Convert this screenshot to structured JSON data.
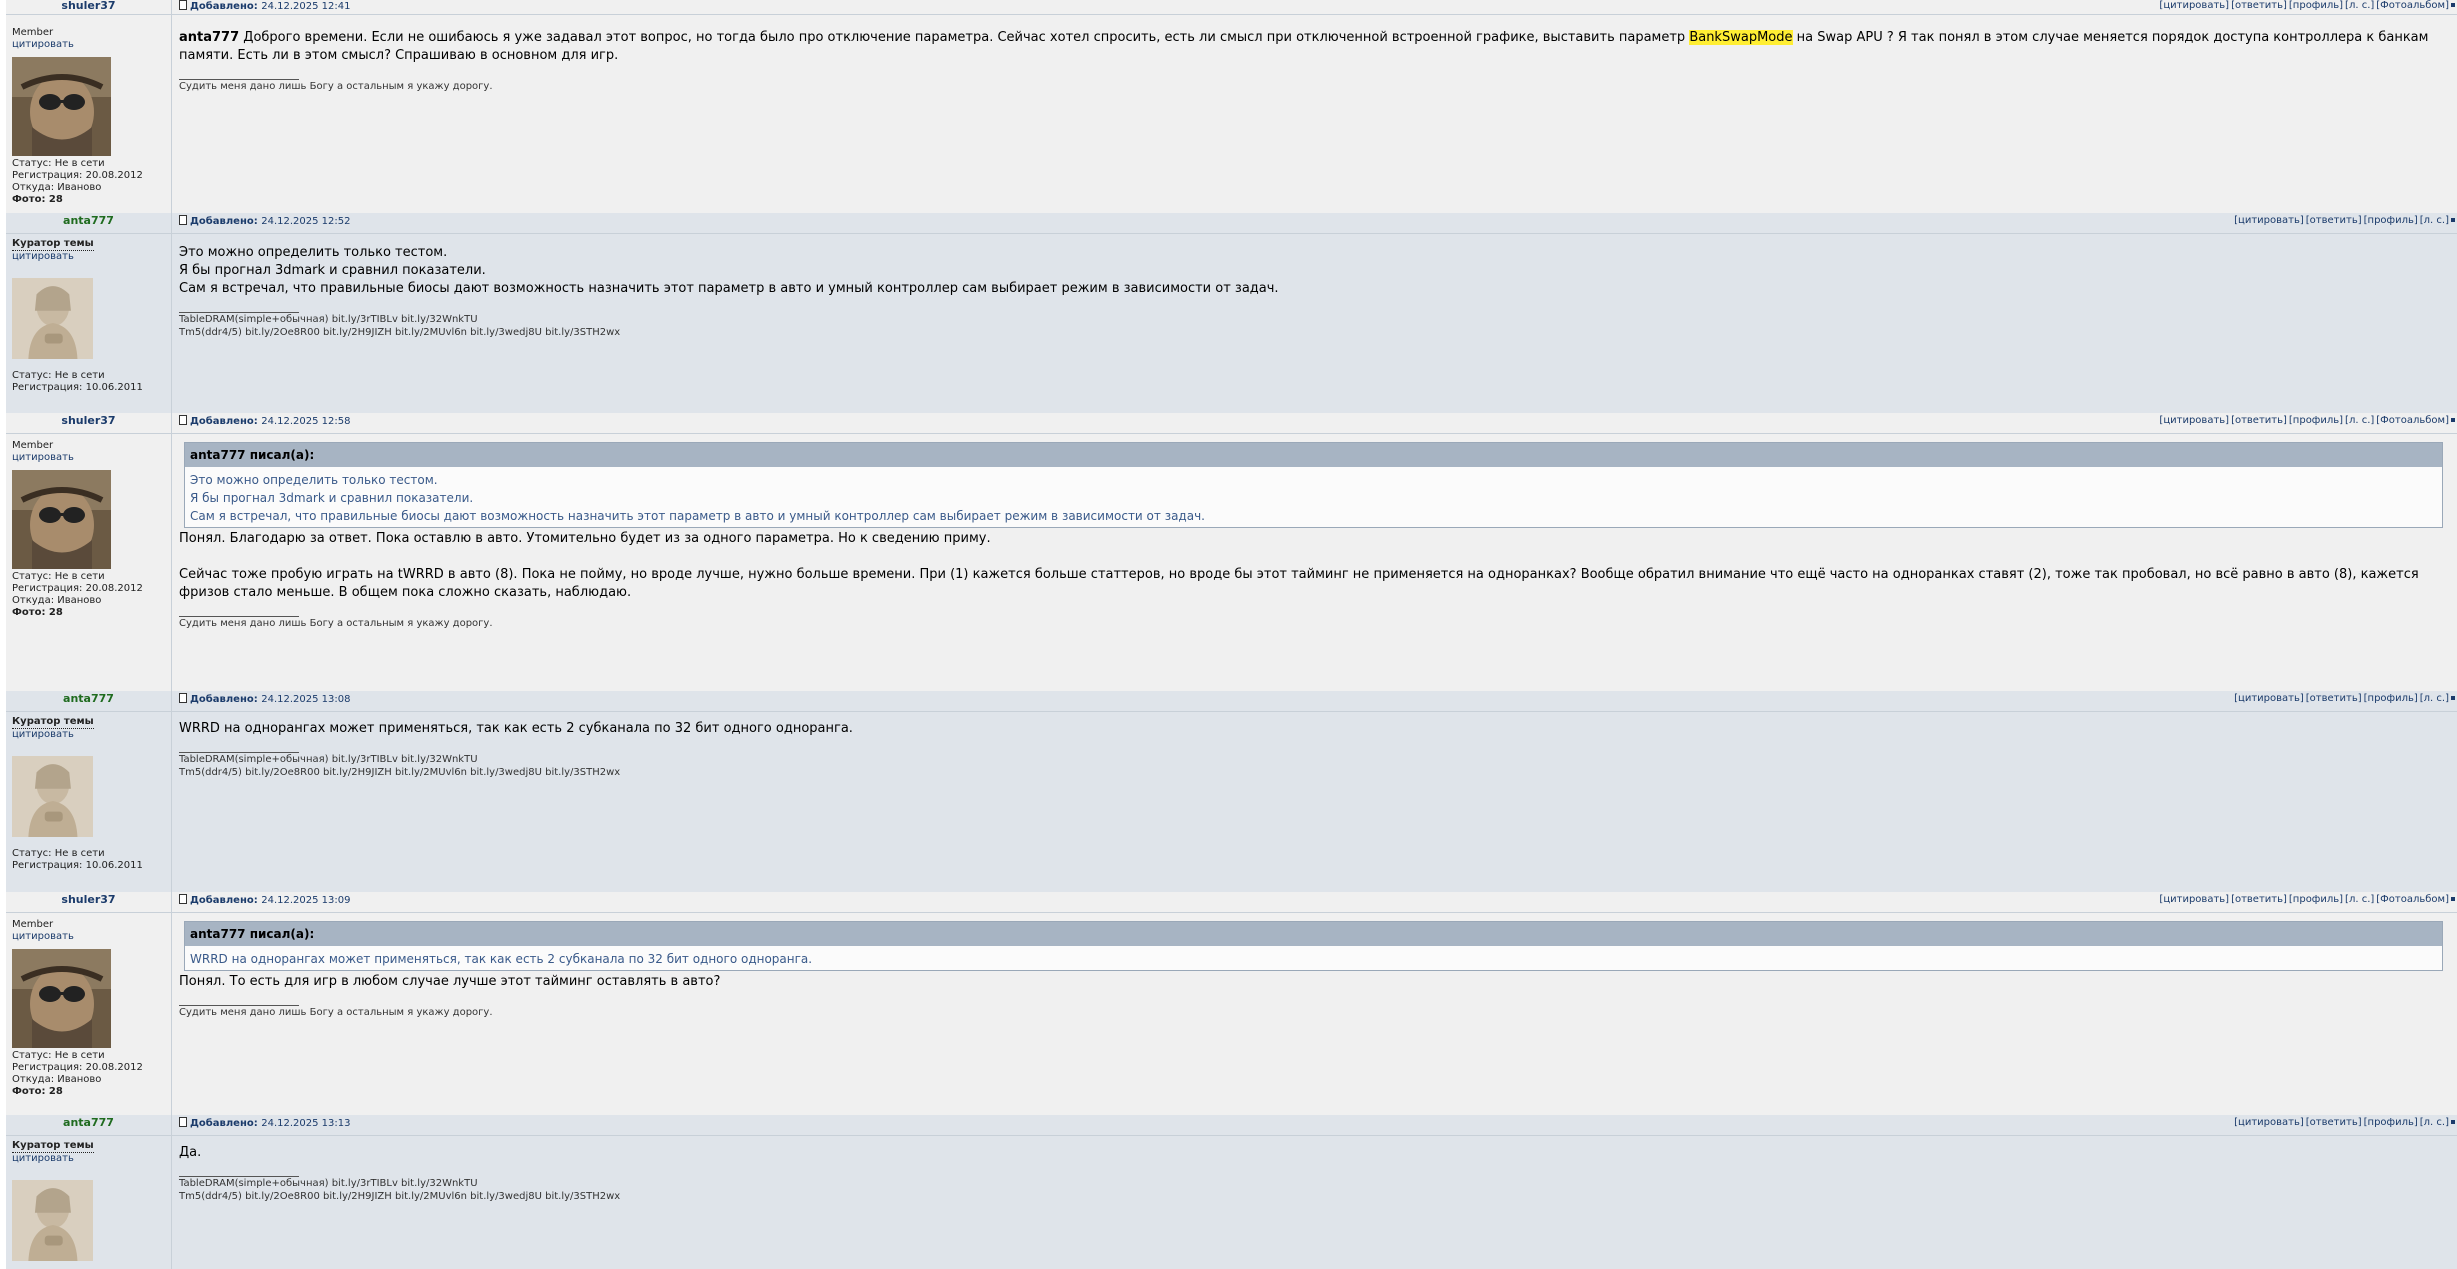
{
  "links_labels": {
    "quote": "[цитировать]",
    "reply": "[ответить]",
    "profile": "[профиль]",
    "pm": "[л. с.]",
    "album": "[Фотоальбом]"
  },
  "added_label": "Добавлено:",
  "posts": [
    {
      "author": "shuler37",
      "date": "24.12.2025 12:41",
      "rank": "Member",
      "cite": "цитировать",
      "status": "Статус: Не в сети",
      "registered": "Регистрация: 20.08.2012",
      "from": "Откуда: Иваново",
      "photo": "Фото: 28",
      "lead_name": "anta777",
      "text_before": " Доброго времени. Если не ошибаюсь я уже задавал этот вопрос, но тогда было про отключение параметра. Сейчас хотел спросить, есть ли смысл при отключенной встроенной графике, выставить параметр ",
      "highlight": "BankSwapMode",
      "text_after": " на Swap APU ? Я так понял в этом случае меняется порядок доступа контроллера к банкам памяти. Есть ли в этом смысл? Спрашиваю в основном для игр.",
      "signature": "Судить меня дано лишь Богу а остальным я укажу дорогу."
    },
    {
      "author": "anta777",
      "date": "24.12.2025 12:52",
      "rank": "Куратор темы",
      "cite": "цитировать",
      "status": "Статус: Не в сети",
      "registered": "Регистрация: 10.06.2011",
      "lines": [
        "Это можно определить только тестом.",
        "Я бы прогнал 3dmark и сравнил показатели.",
        "Сам я встречал, что правильные биосы дают возможность назначить этот параметр в авто и умный контроллер сам выбирает режим в зависимости от задач."
      ],
      "sig1": "TableDRAM(simple+обычная) bit.ly/3rTIBLv bit.ly/32WnkTU",
      "sig2": "Tm5(ddr4/5) bit.ly/2Oe8R00 bit.ly/2H9JIZH bit.ly/2MUvl6n bit.ly/3wedj8U bit.ly/3STH2wx"
    },
    {
      "author": "shuler37",
      "date": "24.12.2025 12:58",
      "rank": "Member",
      "cite": "цитировать",
      "status": "Статус: Не в сети",
      "registered": "Регистрация: 20.08.2012",
      "from": "Откуда: Иваново",
      "photo": "Фото: 28",
      "quote_head": "anta777 писал(а):",
      "quote_lines": [
        "Это можно определить только тестом.",
        "Я бы прогнал 3dmark и сравнил показатели.",
        "Сам я встречал, что правильные биосы дают возможность назначить этот параметр в авто и умный контроллер сам выбирает режим в зависимости от задач."
      ],
      "line1": "Понял. Благодарю за ответ. Пока оставлю в авто. Утомительно будет из за одного параметра. Но к сведению приму.",
      "line2": "Сейчас тоже пробую играть на tWRRD в авто (8). Пока не пойму, но вроде лучше, нужно больше времени. При (1) кажется больше статтеров, но вроде бы этот тайминг не применяется на одноранках? Вообще обратил внимание что ещё часто на одноранках ставят (2), тоже так пробовал, но всё равно в авто (8), кажется фризов стало меньше. В общем пока сложно сказать, наблюдаю.",
      "signature": "Судить меня дано лишь Богу а остальным я укажу дорогу."
    },
    {
      "author": "anta777",
      "date": "24.12.2025 13:08",
      "rank": "Куратор темы",
      "cite": "цитировать",
      "status": "Статус: Не в сети",
      "registered": "Регистрация: 10.06.2011",
      "line1": "WRRD на однорангах может применяться, так как есть 2 субканала по 32 бит одного одноранга.",
      "sig1": "TableDRAM(simple+обычная) bit.ly/3rTIBLv bit.ly/32WnkTU",
      "sig2": "Tm5(ddr4/5) bit.ly/2Oe8R00 bit.ly/2H9JIZH bit.ly/2MUvl6n bit.ly/3wedj8U bit.ly/3STH2wx"
    },
    {
      "author": "shuler37",
      "date": "24.12.2025 13:09",
      "rank": "Member",
      "cite": "цитировать",
      "status": "Статус: Не в сети",
      "registered": "Регистрация: 20.08.2012",
      "from": "Откуда: Иваново",
      "photo": "Фото: 28",
      "quote_head": "anta777 писал(а):",
      "quote_line": "WRRD на однорангах может применяться, так как есть 2 субканала по 32 бит одного одноранга.",
      "line1": "Понял. То есть для игр в любом случае лучше этот тайминг оставлять в авто?",
      "signature": "Судить меня дано лишь Богу а остальным я укажу дорогу."
    },
    {
      "author": "anta777",
      "date": "24.12.2025 13:13",
      "rank": "Куратор темы",
      "cite": "цитировать",
      "line1": "Да.",
      "sig1": "TableDRAM(simple+обычная) bit.ly/3rTIBLv bit.ly/32WnkTU",
      "sig2": "Tm5(ddr4/5) bit.ly/2Oe8R00 bit.ly/2H9JIZH bit.ly/2MUvl6n bit.ly/3wedj8U bit.ly/3STH2wx"
    }
  ]
}
